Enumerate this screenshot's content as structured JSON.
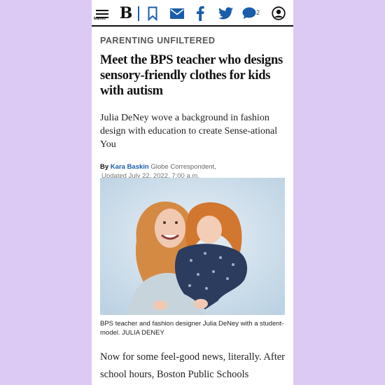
{
  "topbar": {
    "menu_label": "MENU",
    "logo_glyph": "B",
    "comment_count": "2",
    "icons": [
      "menu-icon",
      "globe-logo-icon",
      "bookmark-icon",
      "mail-icon",
      "facebook-icon",
      "twitter-icon",
      "comment-icon",
      "account-icon"
    ],
    "accent_color": "#1a5dab"
  },
  "article": {
    "section": "PARENTING UNFILTERED",
    "headline": "Meet the BPS teacher who designs sensory-friendly clothes for kids with autism",
    "dek": "Julia DeNey wove a background in fashion design with education to create Sense-ational You",
    "byline_prefix": "By",
    "author": "Kara Baskin",
    "author_role": "Globe Correspondent,",
    "updated": "Updated July 22, 2022, 7:00 a.m.",
    "caption_text": "BPS teacher and fashion designer Julia DeNey with a student-model.",
    "caption_credit": "JULIA DENEY",
    "body_start": "Now for some feel-good news, literally. After school hours, Boston Public Schools"
  },
  "colors": {
    "background": "#dccaf4",
    "link_blue": "#1a5dab",
    "text_dark": "#111111"
  }
}
